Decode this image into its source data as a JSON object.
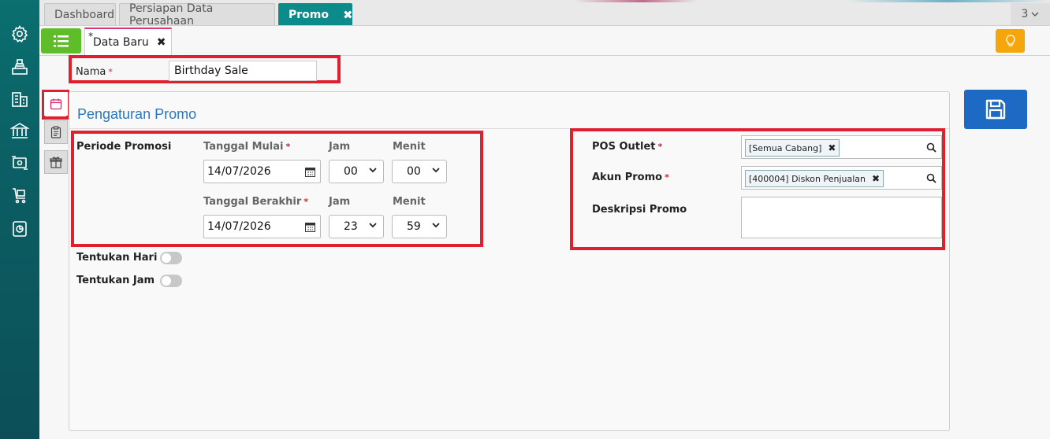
{
  "sidebar": {
    "icons": [
      "gear-icon",
      "cash-register-icon",
      "building-icon",
      "bank-icon",
      "money-cycle-icon",
      "cart-box-icon",
      "report-chart-icon"
    ]
  },
  "tabs": [
    {
      "label": "Dashboard"
    },
    {
      "label": "Persiapan Data Perusahaan"
    },
    {
      "label": "Promo",
      "close": "✖"
    }
  ],
  "tab_count": "3",
  "subtab": {
    "marker": "*",
    "label": "Data Baru",
    "close": "✖"
  },
  "form": {
    "nama_label": "Nama",
    "nama_value": "Birthday Sale",
    "required_mark": "*"
  },
  "panel": {
    "title": "Pengaturan Promo",
    "periode_label": "Periode Promosi",
    "tanggal_mulai_label": "Tanggal Mulai",
    "tanggal_mulai_value": "14/07/2026",
    "jam_label": "Jam",
    "menit_label": "Menit",
    "jam_mulai": "00",
    "menit_mulai": "00",
    "tanggal_berakhir_label": "Tanggal Berakhir",
    "tanggal_berakhir_value": "14/07/2026",
    "jam_berakhir": "23",
    "menit_berakhir": "59",
    "tentukan_hari_label": "Tentukan Hari",
    "tentukan_jam_label": "Tentukan Jam",
    "pos_outlet_label": "POS Outlet",
    "pos_outlet_tag": "[Semua Cabang]",
    "akun_promo_label": "Akun Promo",
    "akun_promo_tag": "[400004] Diskon Penjualan",
    "deskripsi_label": "Deskripsi Promo",
    "deskripsi_value": "",
    "tag_remove": "✖"
  },
  "colors": {
    "accent": "#0d8a8a",
    "save": "#1c6ac4",
    "menu": "#5fbd2a",
    "bulb": "#f4a60a",
    "highlight": "#e0202e"
  }
}
